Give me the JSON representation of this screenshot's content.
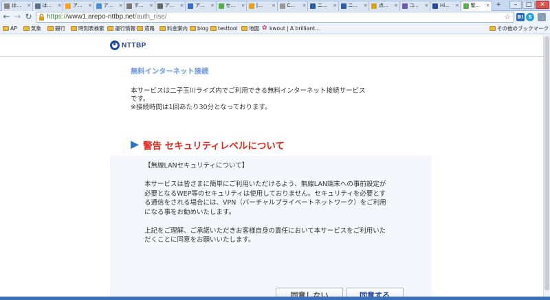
{
  "browser": {
    "tabs": [
      {
        "label": "は...",
        "color": "#888888",
        "active": false
      },
      {
        "label": "は...",
        "color": "#5c6f86",
        "active": false
      },
      {
        "label": "ア...",
        "color": "#f2a31b",
        "active": false
      },
      {
        "label": "ア...",
        "color": "#4a8ad1",
        "active": false
      },
      {
        "label": "す...",
        "color": "#777777",
        "active": false
      },
      {
        "label": "ア...",
        "color": "#666666",
        "active": false
      },
      {
        "label": "ア...",
        "color": "#3a6bc4",
        "active": false
      },
      {
        "label": "セ...",
        "color": "#56b04a",
        "active": false
      },
      {
        "label": "[...",
        "color": "#e8a020",
        "active": false
      },
      {
        "label": "C...",
        "color": "#9a9a9a",
        "active": false
      },
      {
        "label": "ニ...",
        "color": "#2d5ba8",
        "active": false
      },
      {
        "label": "ニ...",
        "color": "#2d5ba8",
        "active": false
      },
      {
        "label": "点...",
        "color": "#d7a21a",
        "active": false
      },
      {
        "label": "コ...",
        "color": "#6b5bb5",
        "active": false
      },
      {
        "label": "Hi...",
        "color": "#2c4a9a",
        "active": false
      },
      {
        "label": "警...",
        "color": "#5ab04e",
        "active": true
      }
    ],
    "new_tab_label": "+",
    "address": {
      "protocol": "https://",
      "host": "www1.arepo-nttbp.net",
      "path": "/auth_rise/"
    },
    "bookmarks": [
      {
        "label": "AP",
        "kind": "folder"
      },
      {
        "label": "気象",
        "kind": "folder"
      },
      {
        "label": "銀行",
        "kind": "folder"
      },
      {
        "label": "時刻表検索",
        "kind": "folder"
      },
      {
        "label": "運行情報",
        "kind": "folder"
      },
      {
        "label": "道路",
        "kind": "folder"
      },
      {
        "label": "料金案内",
        "kind": "folder"
      },
      {
        "label": "blog",
        "kind": "folder"
      },
      {
        "label": "testtool",
        "kind": "folder"
      },
      {
        "label": "地図",
        "kind": "folder"
      },
      {
        "label": "kwout | A brilliant...",
        "kind": "link"
      }
    ],
    "other_bookmarks": "その他のブックマーク",
    "colors": {
      "tabstrip": "#c8daf2",
      "toolbar": "#eef3fa"
    }
  },
  "page": {
    "logo_text": "NTTBP",
    "heading": "無料インターネット接続",
    "intro_lines": [
      "本サービスは二子玉川ライズ内でご利用できる無料インターネット接続サービス",
      "です。",
      "※接続時間は1回あたり30分となっております。"
    ],
    "warning_title": "警告 セキュリティレベルについて",
    "notice": {
      "caption": "【無線LANセキュリティについて】",
      "para1": "本サービスは皆さまに簡単にご利用いただけるよう、無線LAN端末への事前設定が必要となるWEP等のセキュリティは使用しておりません。セキュリティを必要とする通信をされる場合には、VPN（バーチャルプライベートネットワーク）をご利用になる事をお勧めいたします。",
      "para2": "上記をご理解、ご承諾いただきお客様自身の責任において本サービスをご利用いただくことに同意をお願いいたします。"
    },
    "buttons": {
      "disagree": "同意しない",
      "agree": "同意する"
    },
    "colors": {
      "warning_red": "#e0281c",
      "arrow_blue": "#2a78c8",
      "heading_blue": "#7aa2d8",
      "notice_bg": "#f4f8fc"
    }
  }
}
